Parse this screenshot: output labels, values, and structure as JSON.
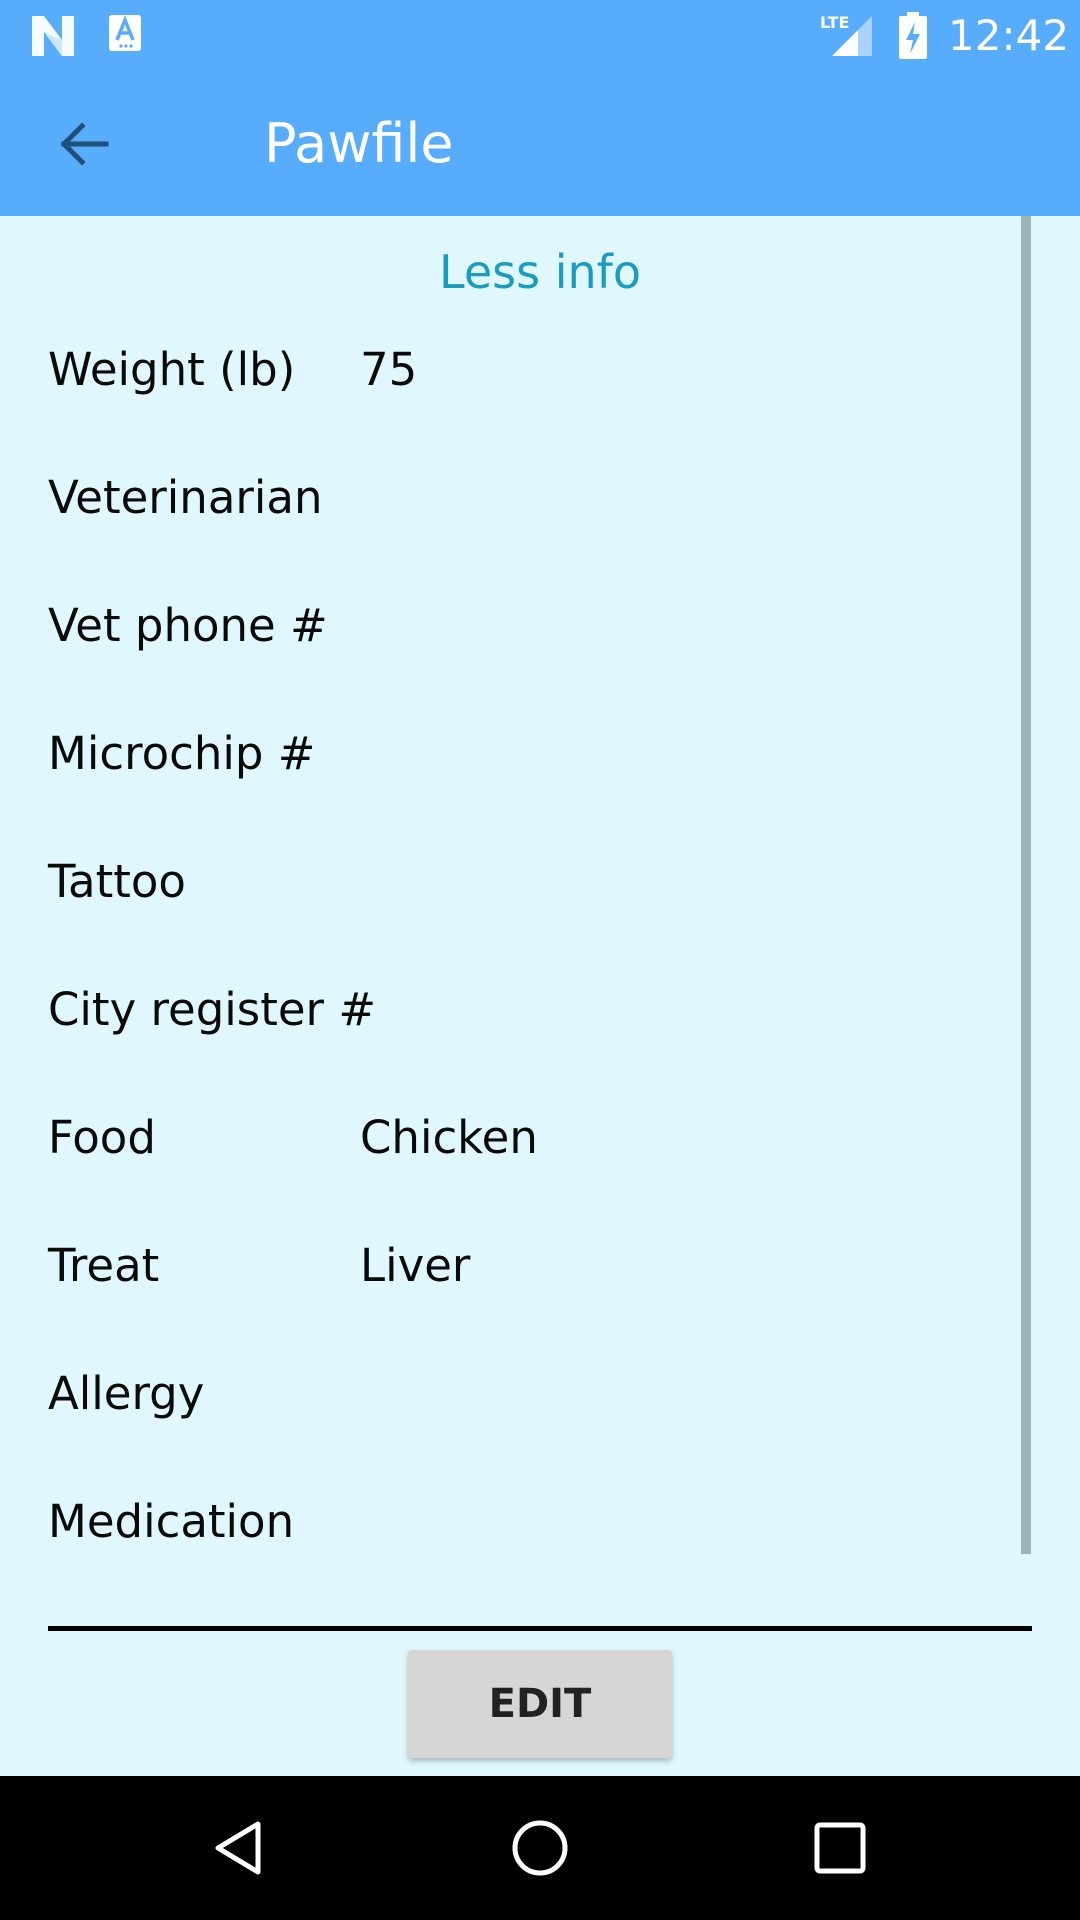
{
  "status_bar": {
    "time": "12:42",
    "icons": [
      "n-notification-icon",
      "a-notification-icon",
      "lte-signal-icon",
      "battery-charging-icon"
    ]
  },
  "app_bar": {
    "title": "Pawfile",
    "back_icon": "arrow-back-icon"
  },
  "content": {
    "toggle_label": "Less info",
    "fields": [
      {
        "label": "Weight (lb)",
        "value": "75"
      },
      {
        "label": "Veterinarian",
        "value": ""
      },
      {
        "label": "Vet phone #",
        "value": ""
      },
      {
        "label": "Microchip #",
        "value": ""
      },
      {
        "label": "Tattoo",
        "value": ""
      },
      {
        "label": "City register #",
        "value": ""
      },
      {
        "label": "Food",
        "value": "Chicken"
      },
      {
        "label": "Treat",
        "value": "Liver"
      },
      {
        "label": "Allergy",
        "value": ""
      },
      {
        "label": "Medication",
        "value": ""
      }
    ],
    "edit_label": "EDIT"
  },
  "nav_bar": {
    "icons": [
      "nav-back-icon",
      "nav-home-icon",
      "nav-recents-icon"
    ]
  },
  "colors": {
    "app_bar": "#58acfc",
    "background": "#e0f8fd",
    "accent_link": "#1a9cc0",
    "button": "#d6d6d6"
  }
}
